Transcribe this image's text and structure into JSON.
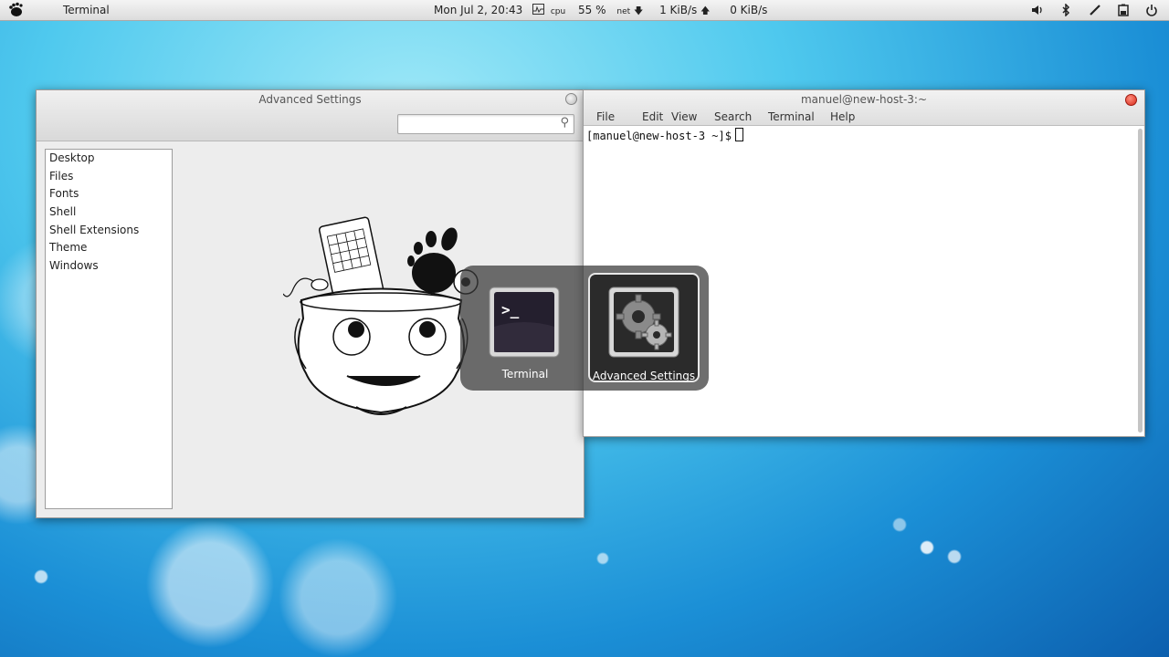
{
  "panel": {
    "activities_icon": "gnome-foot-icon",
    "app_name": "Terminal",
    "clock": "Mon Jul  2, 20:43",
    "cpu_label": "cpu",
    "cpu_value": "55 %",
    "net_label": "net",
    "down_rate": "1 KiB/s",
    "up_rate": "0 KiB/s",
    "tray_icons": [
      "volume-icon",
      "bluetooth-icon",
      "pen-icon",
      "battery-icon",
      "power-icon"
    ]
  },
  "advanced_settings": {
    "title": "Advanced Settings",
    "search_placeholder": "",
    "sidebar": [
      "Desktop",
      "Files",
      "Fonts",
      "Shell",
      "Shell Extensions",
      "Theme",
      "Windows"
    ]
  },
  "terminal": {
    "title": "manuel@new-host-3:~",
    "menu": [
      "File",
      "Edit",
      "View",
      "Search",
      "Terminal",
      "Help"
    ],
    "prompt": "[manuel@new-host-3 ~]$"
  },
  "switcher": {
    "items": [
      {
        "label": "Terminal",
        "icon": "terminal-icon",
        "selected": false
      },
      {
        "label": "Advanced Settings",
        "icon": "gear-icon",
        "selected": true
      }
    ]
  }
}
